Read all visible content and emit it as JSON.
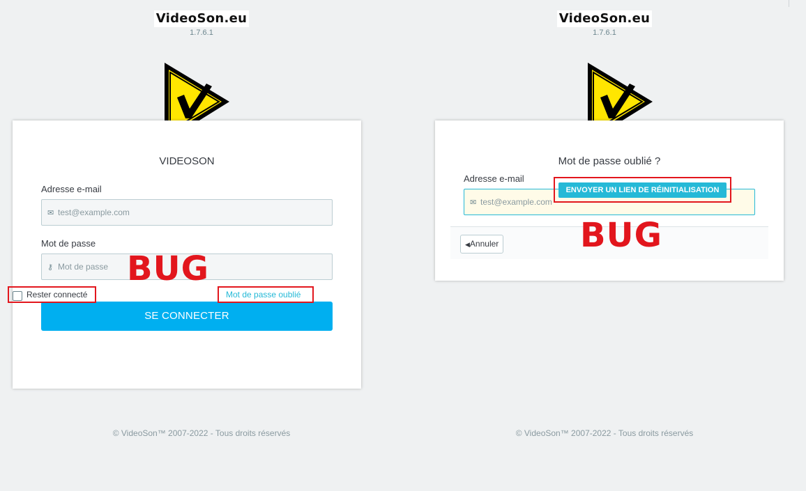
{
  "colors": {
    "accent": "#25b9d7",
    "primary_button": "#00aff0",
    "bug_red": "#e2161d",
    "logo_yellow": "#ffe600"
  },
  "left": {
    "brand": {
      "name": "VideoSon.eu",
      "version": "1.7.6.1"
    },
    "logo_icon": "warning-check-logo-icon",
    "card": {
      "title": "VIDEOSON",
      "email_label": "Adresse e-mail",
      "email_placeholder": "test@example.com",
      "email_icon": "envelope-icon",
      "password_label": "Mot de passe",
      "password_placeholder": "Mot de passe",
      "password_icon": "key-icon",
      "remember_label": "Rester connecté",
      "remember_checked": false,
      "forgot_link": "Mot de passe oublié",
      "login_button": "SE CONNECTER"
    },
    "bug_label": "BUG",
    "copyright": "© VideoSon™ 2007-2022 - Tous droits réservés"
  },
  "right": {
    "brand": {
      "name": "VideoSon.eu",
      "version": "1.7.6.1"
    },
    "logo_icon": "warning-check-logo-icon",
    "card": {
      "title": "Mot de passe oublié ?",
      "email_label": "Adresse e-mail",
      "email_placeholder": "test@example.com",
      "email_icon": "envelope-icon",
      "send_button": "ENVOYER UN LIEN DE RÉINITIALISATION",
      "cancel_button": "Annuler",
      "cancel_icon": "caret-left-icon"
    },
    "bug_label": "BUG",
    "copyright": "© VideoSon™ 2007-2022 - Tous droits réservés"
  }
}
